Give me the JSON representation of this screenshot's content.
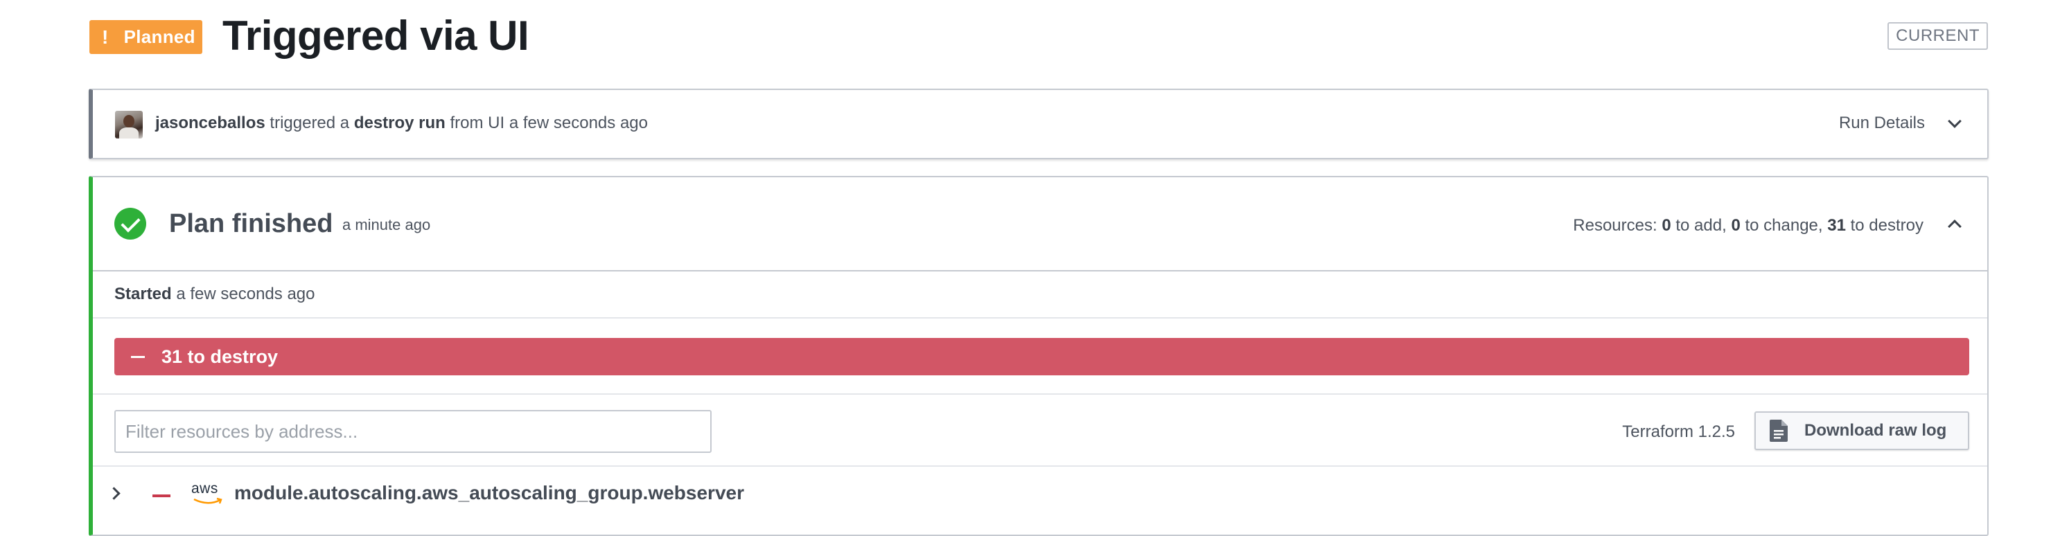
{
  "header": {
    "status_badge": {
      "icon": "!",
      "label": "Planned",
      "color": "#f79d3c"
    },
    "title": "Triggered via UI",
    "current_badge": "CURRENT"
  },
  "trigger": {
    "user": "jasonceballos",
    "text_1": " triggered a ",
    "run_type": "destroy run",
    "text_2": " from UI a few seconds ago",
    "run_details_label": "Run Details"
  },
  "plan": {
    "title": "Plan finished",
    "time": "a minute ago",
    "status_color": "#2eb039",
    "resources": {
      "prefix": "Resources: ",
      "add_count": "0",
      "add_label": " to add, ",
      "change_count": "0",
      "change_label": " to change, ",
      "destroy_count": "31",
      "destroy_label": " to destroy"
    },
    "started": {
      "label": "Started",
      "time": " a few seconds ago"
    },
    "destroy_bar": {
      "label": "31 to destroy",
      "color": "#d25666"
    },
    "filter": {
      "placeholder": "Filter resources by address...",
      "value": ""
    },
    "terraform_version": "Terraform 1.2.5",
    "download_label": "Download raw log",
    "resources_list": [
      {
        "provider": "aws",
        "address": "module.autoscaling.aws_autoscaling_group.webserver",
        "action": "destroy"
      }
    ]
  }
}
